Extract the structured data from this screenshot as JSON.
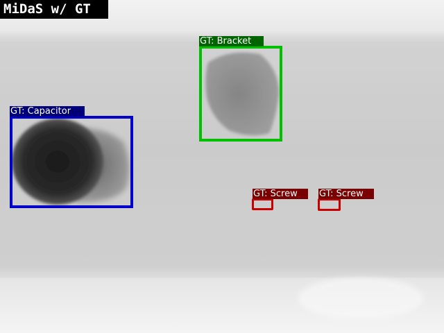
{
  "title": "MiDaS w/ GT",
  "colors": {
    "green": "#00c000",
    "blue": "#0000c8",
    "red": "#c80000",
    "green_label_bg": "#006400",
    "blue_label_bg": "#000078",
    "red_label_bg": "#780000"
  },
  "boxes": [
    {
      "id": "bracket",
      "label": "GT: Bracket"
    },
    {
      "id": "capacitor",
      "label": "GT: Capacitor"
    },
    {
      "id": "screw-1",
      "label": "GT: Screw"
    },
    {
      "id": "screw-2",
      "label": "GT: Screw"
    }
  ]
}
